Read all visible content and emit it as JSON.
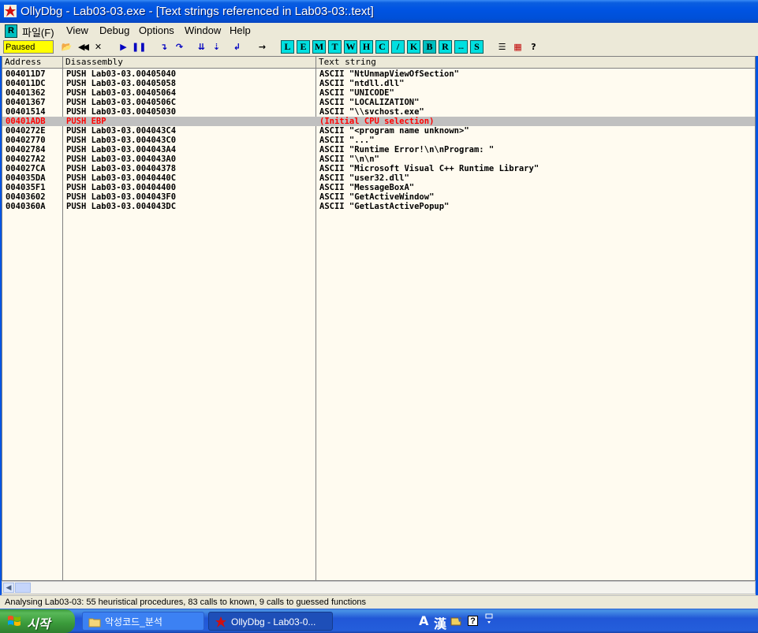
{
  "window": {
    "title": "OllyDbg - Lab03-03.exe - [Text strings referenced in Lab03-03:.text]"
  },
  "menu": {
    "mdi_icon_label": "R",
    "items": [
      "파일(F)",
      "View",
      "Debug",
      "Options",
      "Window",
      "Help"
    ]
  },
  "toolbar": {
    "status": "Paused",
    "status_color": "#ffff00",
    "buttons": [
      {
        "name": "open-icon",
        "glyph": "📂"
      },
      {
        "name": "restart-icon",
        "glyph": "◀◀"
      },
      {
        "name": "close-icon",
        "glyph": "✕"
      },
      {
        "name": "run-icon",
        "glyph": "▶"
      },
      {
        "name": "pause-icon",
        "glyph": "❚❚"
      },
      {
        "name": "step-into-icon",
        "glyph": "↴"
      },
      {
        "name": "step-over-icon",
        "glyph": "↷"
      },
      {
        "name": "trace-into-icon",
        "glyph": "⇊"
      },
      {
        "name": "trace-over-icon",
        "glyph": "⇣"
      },
      {
        "name": "execute-till-return-icon",
        "glyph": "↲"
      },
      {
        "name": "goto-icon",
        "glyph": "→"
      }
    ],
    "window_letters": [
      "L",
      "E",
      "M",
      "T",
      "W",
      "H",
      "C",
      "/",
      "K",
      "B",
      "R",
      "...",
      "S"
    ],
    "view_buttons": [
      {
        "name": "list-icon",
        "glyph": "☰"
      },
      {
        "name": "colors-icon",
        "glyph": "▦"
      },
      {
        "name": "help-icon",
        "glyph": "?"
      }
    ]
  },
  "table": {
    "columns": [
      "Address",
      "Disassembly",
      "Text string"
    ],
    "rows": [
      {
        "address": "004011D7",
        "disassembly": "PUSH Lab03-03.00405040",
        "text": "ASCII \"NtUnmapViewOfSection\""
      },
      {
        "address": "004011DC",
        "disassembly": "PUSH Lab03-03.00405058",
        "text": "ASCII \"ntdll.dll\""
      },
      {
        "address": "00401362",
        "disassembly": "PUSH Lab03-03.00405064",
        "text": "ASCII \"UNICODE\""
      },
      {
        "address": "00401367",
        "disassembly": "PUSH Lab03-03.0040506C",
        "text": "ASCII \"LOCALIZATION\""
      },
      {
        "address": "00401514",
        "disassembly": "PUSH Lab03-03.00405030",
        "text": "ASCII \"\\\\svchost.exe\""
      },
      {
        "address": "00401ADB",
        "disassembly": "PUSH EBP",
        "text": "(Initial CPU selection)",
        "selected": true
      },
      {
        "address": "0040272E",
        "disassembly": "PUSH Lab03-03.004043C4",
        "text": "ASCII \"<program name unknown>\""
      },
      {
        "address": "00402770",
        "disassembly": "PUSH Lab03-03.004043C0",
        "text": "ASCII \"...\""
      },
      {
        "address": "00402784",
        "disassembly": "PUSH Lab03-03.004043A4",
        "text": "ASCII \"Runtime Error!\\n\\nProgram: \""
      },
      {
        "address": "004027A2",
        "disassembly": "PUSH Lab03-03.004043A0",
        "text": "ASCII \"\\n\\n\""
      },
      {
        "address": "004027CA",
        "disassembly": "PUSH Lab03-03.00404378",
        "text": "ASCII \"Microsoft Visual C++ Runtime Library\""
      },
      {
        "address": "004035DA",
        "disassembly": "PUSH Lab03-03.0040440C",
        "text": "ASCII \"user32.dll\""
      },
      {
        "address": "004035F1",
        "disassembly": "PUSH Lab03-03.00404400",
        "text": "ASCII \"MessageBoxA\""
      },
      {
        "address": "00403602",
        "disassembly": "PUSH Lab03-03.004043F0",
        "text": "ASCII \"GetActiveWindow\""
      },
      {
        "address": "0040360A",
        "disassembly": "PUSH Lab03-03.004043DC",
        "text": "ASCII \"GetLastActivePopup\""
      }
    ],
    "selected_color": "#ff0000"
  },
  "statusbar": {
    "text": "Analysing Lab03-03: 55 heuristical procedures, 83 calls to known, 9 calls to guessed functions"
  },
  "taskbar": {
    "start_label": "시작",
    "tasks": [
      {
        "label": "악성코드_분석",
        "icon": "folder-icon"
      },
      {
        "label": "OllyDbg - Lab03-0...",
        "icon": "ollydbg-icon"
      }
    ],
    "tray": {
      "ime_mode": "A",
      "ime_hanja": "漢",
      "help": "?"
    }
  }
}
